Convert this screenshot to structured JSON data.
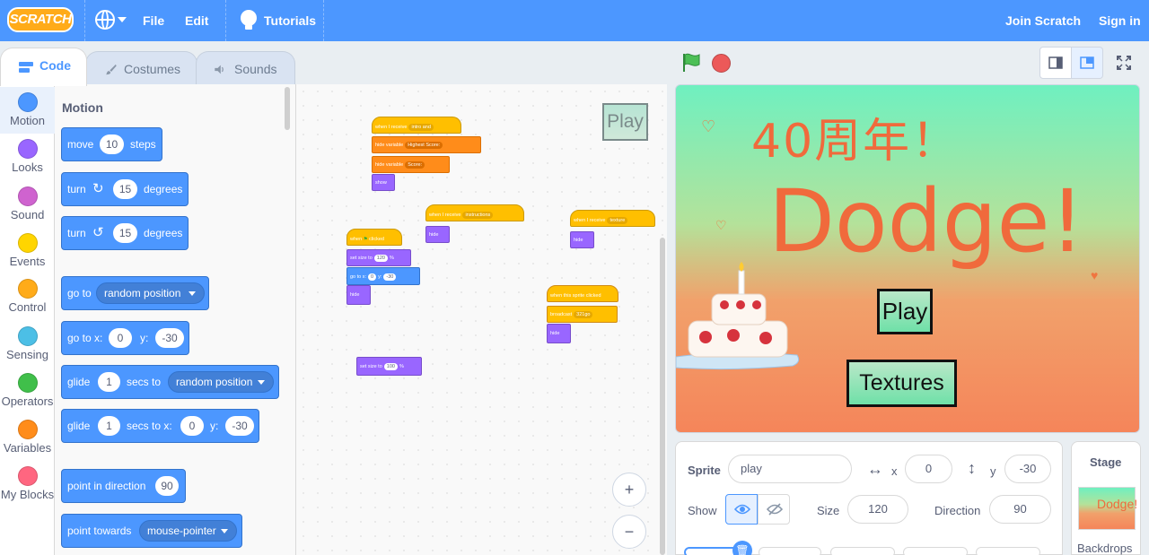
{
  "menu": {
    "logo": "SCRATCH",
    "file": "File",
    "edit": "Edit",
    "tutorials": "Tutorials",
    "join": "Join Scratch",
    "signin": "Sign in"
  },
  "tabs": [
    "Code",
    "Costumes",
    "Sounds"
  ],
  "categories": [
    {
      "label": "Motion",
      "color": "#4c97ff"
    },
    {
      "label": "Looks",
      "color": "#9966ff"
    },
    {
      "label": "Sound",
      "color": "#cf63cf"
    },
    {
      "label": "Events",
      "color": "#ffd500"
    },
    {
      "label": "Control",
      "color": "#ffab19"
    },
    {
      "label": "Sensing",
      "color": "#4cbfe6"
    },
    {
      "label": "Operators",
      "color": "#40bf4a"
    },
    {
      "label": "Variables",
      "color": "#ff8c1a"
    },
    {
      "label": "My Blocks",
      "color": "#ff6680"
    }
  ],
  "palette": {
    "title": "Motion",
    "move": {
      "t1": "move",
      "v": "10",
      "t2": "steps"
    },
    "turn_right": {
      "t1": "turn",
      "v": "15",
      "t2": "degrees"
    },
    "turn_left": {
      "t1": "turn",
      "v": "15",
      "t2": "degrees"
    },
    "goto": {
      "t1": "go to",
      "dd": "random position"
    },
    "goto_xy": {
      "t1": "go to x:",
      "x": "0",
      "t2": "y:",
      "y": "-30"
    },
    "glide_to": {
      "t1": "glide",
      "v": "1",
      "t2": "secs to",
      "dd": "random position"
    },
    "glide_xy": {
      "t1": "glide",
      "v": "1",
      "t2": "secs to x:",
      "x": "0",
      "t3": "y:",
      "y": "-30"
    },
    "point_dir": {
      "t1": "point in direction",
      "v": "90"
    },
    "point_towards": {
      "t1": "point towards",
      "dd": "mouse-pointer"
    }
  },
  "scripts": {
    "s1": {
      "hat": "when I receive",
      "hat_v": "intro and",
      "b1": "hide variable",
      "b1_v": "Highest Score:",
      "b2": "hide variable",
      "b2_v": "Score:",
      "b3": "show"
    },
    "s2": {
      "hat": "when I receive",
      "hat_v": "instructions",
      "b1": "hide"
    },
    "s3": {
      "hat": "when I receive",
      "hat_v": "texture",
      "b1": "hide"
    },
    "s4": {
      "hat": "when",
      "hat_t2": "clicked",
      "b1": "set size to",
      "b1_v": "120",
      "b1_t2": "%",
      "b2": "go to x:",
      "b2_x": "0",
      "b2_t2": "y:",
      "b2_y": "-30",
      "b3": "hide"
    },
    "s5": {
      "hat": "when this sprite clicked",
      "b1": "broadcast",
      "b1_v": "321go",
      "b2": "hide"
    },
    "s6": {
      "b1": "set size to",
      "b1_v": "100",
      "b1_t2": "%"
    },
    "ghost_label": "Play"
  },
  "zoom": {
    "in": "+",
    "out": "−"
  },
  "stage": {
    "title": "40周年！",
    "game_title": "Dodge!",
    "play_button": "Play",
    "textures_button": "Textures"
  },
  "sprite_info": {
    "sprite_label": "Sprite",
    "sprite_name": "play",
    "x_label": "x",
    "x": "0",
    "y_label": "y",
    "y": "-30",
    "show_label": "Show",
    "size_label": "Size",
    "size": "120",
    "direction_label": "Direction",
    "direction": "90"
  },
  "stage_panel": {
    "title": "Stage",
    "backdrops_label": "Backdrops"
  }
}
